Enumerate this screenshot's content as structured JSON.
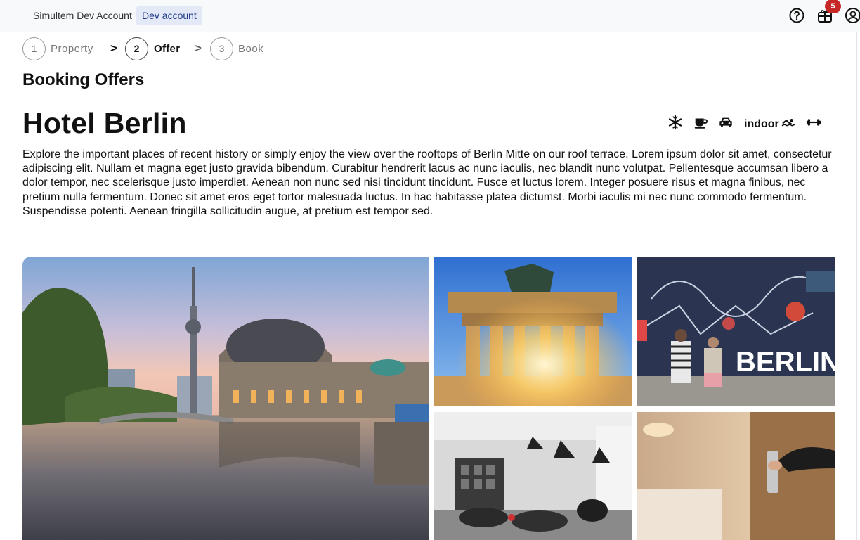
{
  "topbar": {
    "account_name": "Simultem Dev Account",
    "account_badge": "Dev account",
    "notifications_count": "5",
    "icons": [
      "help-icon",
      "gift-icon",
      "user-account-icon"
    ]
  },
  "stepper": {
    "steps": [
      {
        "number": "1",
        "label": "Property",
        "state": "done"
      },
      {
        "number": "2",
        "label": "Offer",
        "state": "active"
      },
      {
        "number": "3",
        "label": "Book",
        "state": "upcoming"
      }
    ],
    "separator": ">"
  },
  "page": {
    "section_title": "Booking Offers",
    "hotel_name": "Hotel Berlin",
    "amenities": [
      {
        "icon": "snowflake-icon"
      },
      {
        "icon": "coffee-icon"
      },
      {
        "icon": "car-icon"
      },
      {
        "label": "indoor",
        "icon": "swimming-icon"
      },
      {
        "icon": "dumbbell-icon"
      }
    ],
    "description": "Explore the important places of recent history or simply enjoy the view over the rooftops of Berlin Mitte on our roof terrace. Lorem ipsum dolor sit amet, consectetur adipiscing elit. Nullam et magna eget justo gravida bibendum. Curabitur hendrerit lacus ac nunc iaculis, nec blandit nunc volutpat. Pellentesque accumsan libero a dolor tempor, nec scelerisque justo imperdiet. Aenean non nunc sed nisi tincidunt tincidunt. Fusce et luctus lorem. Integer posuere risus et magna finibus, nec pretium nulla fermentum. Donec sit amet eros eget tortor malesuada luctus. In hac habitasse platea dictumst. Morbi iaculis mi nec nunc commodo fermentum. Suspendisse potenti. Aenean fringilla sollicitudin augue, at pretium est tempor sed."
  },
  "gallery": {
    "images": [
      {
        "subject": "Museum Island and TV tower at sunset"
      },
      {
        "subject": "Brandenburg Gate"
      },
      {
        "subject": "Berlin Wall graffiti",
        "graffiti_text": "BERLIN"
      },
      {
        "subject": "Hotel lounge"
      },
      {
        "subject": "Hotel room door"
      }
    ]
  },
  "colors": {
    "topbar_bg": "#f8f9fa",
    "badge_bg": "#e4e9f7",
    "badge_text": "#1f3a8a",
    "notification_red": "#c62828",
    "text": "#111111"
  }
}
